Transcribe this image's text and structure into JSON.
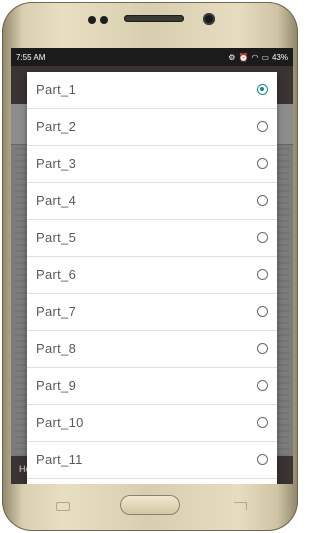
{
  "status_bar": {
    "time": "7:55 AM",
    "battery": "43%"
  },
  "background_app": {
    "footer_left": "Home"
  },
  "dialog": {
    "options": [
      {
        "label": "Part_1",
        "selected": true
      },
      {
        "label": "Part_2",
        "selected": false
      },
      {
        "label": "Part_3",
        "selected": false
      },
      {
        "label": "Part_4",
        "selected": false
      },
      {
        "label": "Part_5",
        "selected": false
      },
      {
        "label": "Part_6",
        "selected": false
      },
      {
        "label": "Part_7",
        "selected": false
      },
      {
        "label": "Part_8",
        "selected": false
      },
      {
        "label": "Part_9",
        "selected": false
      },
      {
        "label": "Part_10",
        "selected": false
      },
      {
        "label": "Part_11",
        "selected": false
      }
    ]
  },
  "colors": {
    "accent": "#1a8c82"
  }
}
